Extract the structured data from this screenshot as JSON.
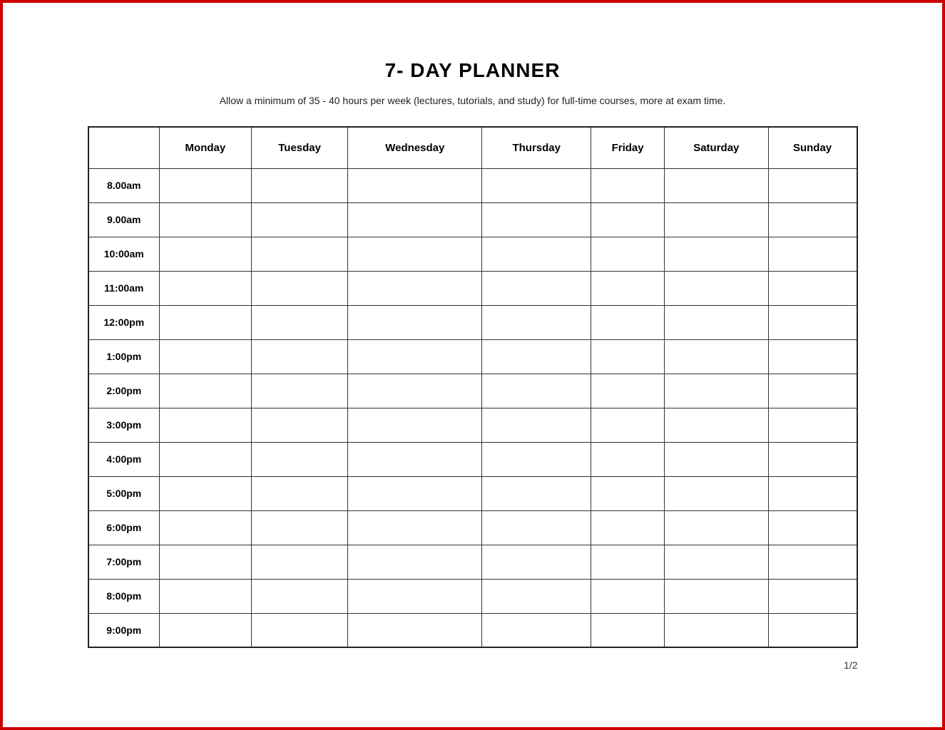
{
  "title": "7- DAY PLANNER",
  "subtitle": "Allow a minimum of 35 - 40 hours per week (lectures, tutorials, and study) for full-time courses, more at exam time.",
  "days": [
    "Monday",
    "Tuesday",
    "Wednesday",
    "Thursday",
    "Friday",
    "Saturday",
    "Sunday"
  ],
  "times": [
    "8.00am",
    "9.00am",
    "10:00am",
    "11:00am",
    "12:00pm",
    "1:00pm",
    "2:00pm",
    "3:00pm",
    "4:00pm",
    "5:00pm",
    "6:00pm",
    "7:00pm",
    "8:00pm",
    "9:00pm"
  ],
  "page_number": "1/2"
}
